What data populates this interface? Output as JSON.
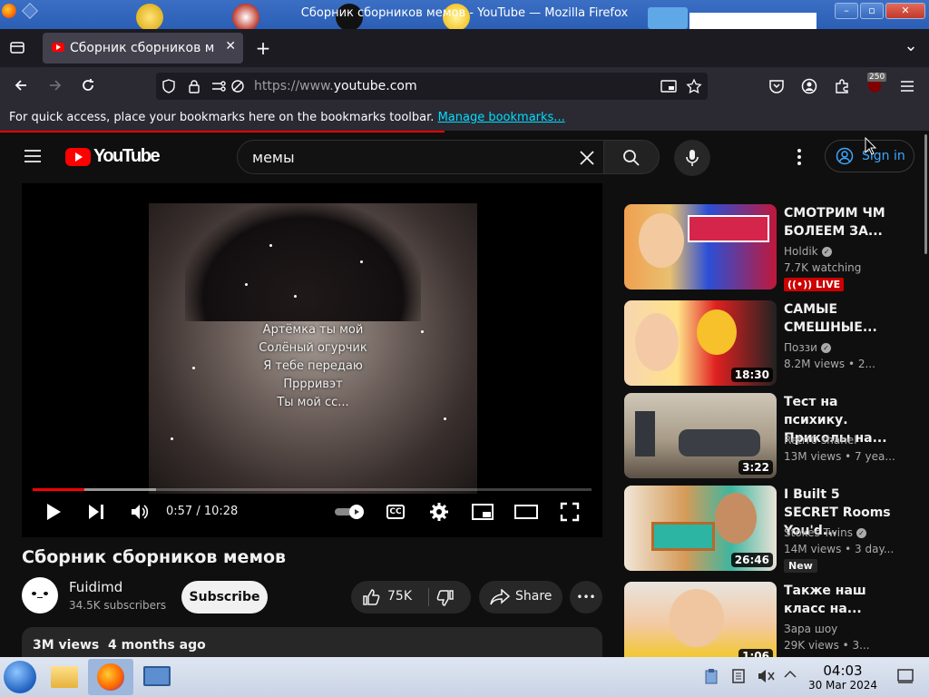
{
  "window": {
    "title": "Сборник сборников мемов - YouTube — Mozilla Firefox",
    "minimize": "–",
    "maximize": "▫",
    "close": "✕"
  },
  "browser": {
    "tab_title": "Сборник сборников мемов - YouTube",
    "tab_close": "✕",
    "new_tab": "+",
    "tab_list": "⌄",
    "url_prefix": "https://www.",
    "url_domain": "youtube.com",
    "extension_badge": "250",
    "bookmarks_text": "For quick access, place your bookmarks here on the bookmarks toolbar.",
    "bookmarks_link": "Manage bookmarks..."
  },
  "youtube": {
    "logo_text": "YouTube",
    "search_value": "мемы",
    "sign_in": "Sign in"
  },
  "player": {
    "lyrics": [
      "Артёмка ты мой",
      "Солёный огурчик",
      "Я тебе передаю",
      "Пррривэт",
      "Ты мой сс..."
    ],
    "time": "0:57 / 10:28",
    "progress": 0.092,
    "buffered": 0.22,
    "cc_label": "CC"
  },
  "video": {
    "title": "Сборник сборников мемов",
    "channel": "Fuidimd",
    "subscribers": "34.5K subscribers",
    "subscribe": "Subscribe",
    "likes": "75K",
    "share": "Share",
    "more": "•••",
    "views": "3M views",
    "age": "4 months ago"
  },
  "related": [
    {
      "title": "СМОТРИМ ЧМ БОЛЕЕМ ЗА...",
      "channel": "Holdik",
      "meta": "7.7K watching",
      "badge": "LIVE",
      "duration": ""
    },
    {
      "title": "САМЫЕ СМЕШНЫЕ...",
      "channel": "Поззи",
      "meta": "8.2M views  • 2...",
      "badge": "",
      "duration": "18:30"
    },
    {
      "title": "Тест на психику. Приколы на...",
      "channel": "Retrr0 shanel",
      "meta": "13M views  • 7 yea...",
      "badge": "",
      "duration": "3:22"
    },
    {
      "title": "I Built 5 SECRET Rooms You'd...",
      "channel": "Stokes Twins",
      "meta": "14M views  • 3 day...",
      "badge": "New",
      "duration": "26:46"
    },
    {
      "title": "Также наш класс на...",
      "channel": "Зара шоу",
      "meta": "29K views  • 3...",
      "badge": "",
      "duration": "1:06"
    }
  ],
  "taskbar": {
    "time": "04:03",
    "date": "30 Mar 2024"
  },
  "colors": {
    "youtube_red": "#ff0000",
    "link_blue": "#3ea6ff",
    "firefox_link": "#00ddff",
    "titlebar_blue": "#2b5eb5"
  }
}
